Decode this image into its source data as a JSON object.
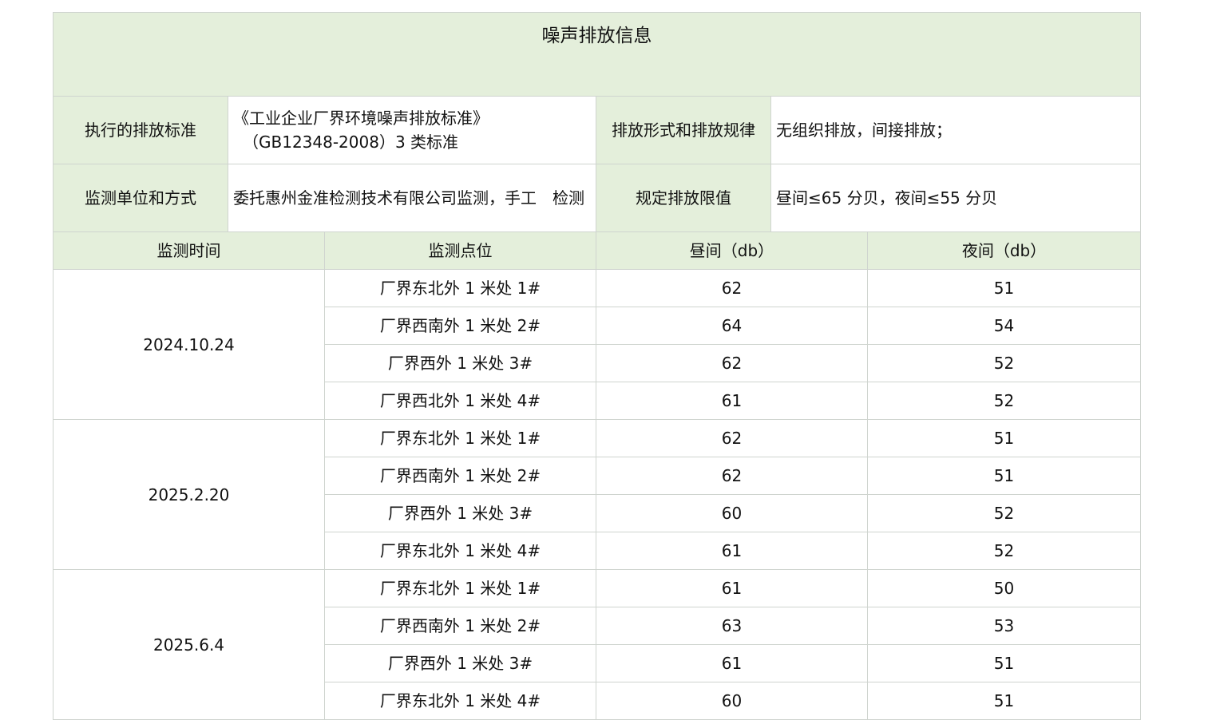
{
  "title": "噪声排放信息",
  "info": {
    "standard_label": "执行的排放标准",
    "standard_value_line1": "《工业企业厂界环境噪声排放标准》",
    "standard_value_line2": "（GB12348-2008）3 类标准",
    "emission_form_label": "排放形式和排放规律",
    "emission_form_value": "无组织排放，间接排放；",
    "monitor_label": "监测单位和方式",
    "monitor_value": "委托惠州金准检测技术有限公司监测，手工　检测",
    "limit_label": "规定排放限值",
    "limit_value": "昼间≤65 分贝，夜间≤55 分贝"
  },
  "columns": [
    "监测时间",
    "监测点位",
    "昼间（db）",
    "夜间（db）"
  ],
  "groups": [
    {
      "date": "2024.10.24",
      "rows": [
        {
          "point": "厂界东北外 1 米处 1#",
          "day": "62",
          "night": "51"
        },
        {
          "point": "厂界西南外 1 米处 2#",
          "day": "64",
          "night": "54"
        },
        {
          "point": "厂界西外 1 米处 3#",
          "day": "62",
          "night": "52"
        },
        {
          "point": "厂界西北外 1 米处 4#",
          "day": "61",
          "night": "52"
        }
      ]
    },
    {
      "date": "2025.2.20",
      "rows": [
        {
          "point": "厂界东北外 1 米处 1#",
          "day": "62",
          "night": "51"
        },
        {
          "point": "厂界西南外 1 米处 2#",
          "day": "62",
          "night": "51"
        },
        {
          "point": "厂界西外 1 米处 3#",
          "day": "60",
          "night": "52"
        },
        {
          "point": "厂界东北外 1 米处 4#",
          "day": "61",
          "night": "52"
        }
      ]
    },
    {
      "date": "2025.6.4",
      "rows": [
        {
          "point": "厂界东北外 1 米处 1#",
          "day": "61",
          "night": "50"
        },
        {
          "point": "厂界西南外 1 米处 2#",
          "day": "63",
          "night": "53"
        },
        {
          "point": "厂界西外 1 米处 3#",
          "day": "61",
          "night": "51"
        },
        {
          "point": "厂界东北外 1 米处 4#",
          "day": "60",
          "night": "51"
        }
      ]
    }
  ],
  "colors": {
    "header_bg": "#e4efdb",
    "border": "#cfd4cf"
  }
}
